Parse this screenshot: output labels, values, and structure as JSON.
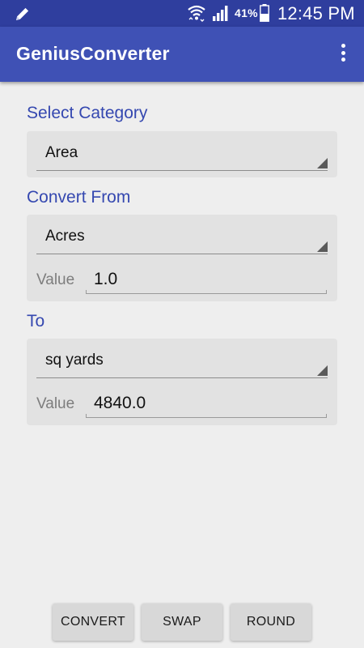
{
  "status_bar": {
    "battery_percent": "41%",
    "time": "12:45 PM",
    "icons": [
      "pencil-icon",
      "wifi-icon",
      "signal-icon",
      "battery-icon"
    ]
  },
  "app_bar": {
    "title": "GeniusConverter",
    "menu_icon": "overflow-menu-icon"
  },
  "category": {
    "label": "Select Category",
    "selected": "Area"
  },
  "convert_from": {
    "label": "Convert From",
    "unit": "Acres",
    "value_label": "Value",
    "value": "1.0"
  },
  "convert_to": {
    "label": "To",
    "unit": "sq yards",
    "value_label": "Value",
    "value": "4840.0"
  },
  "buttons": {
    "convert": "CONVERT",
    "swap": "SWAP",
    "round": "ROUND"
  },
  "colors": {
    "status_bar": "#2f3e9e",
    "app_bar": "#3f51b5",
    "section_label": "#3548b0",
    "card_background": "#e2e2e2",
    "screen_background": "#eeeeee"
  }
}
